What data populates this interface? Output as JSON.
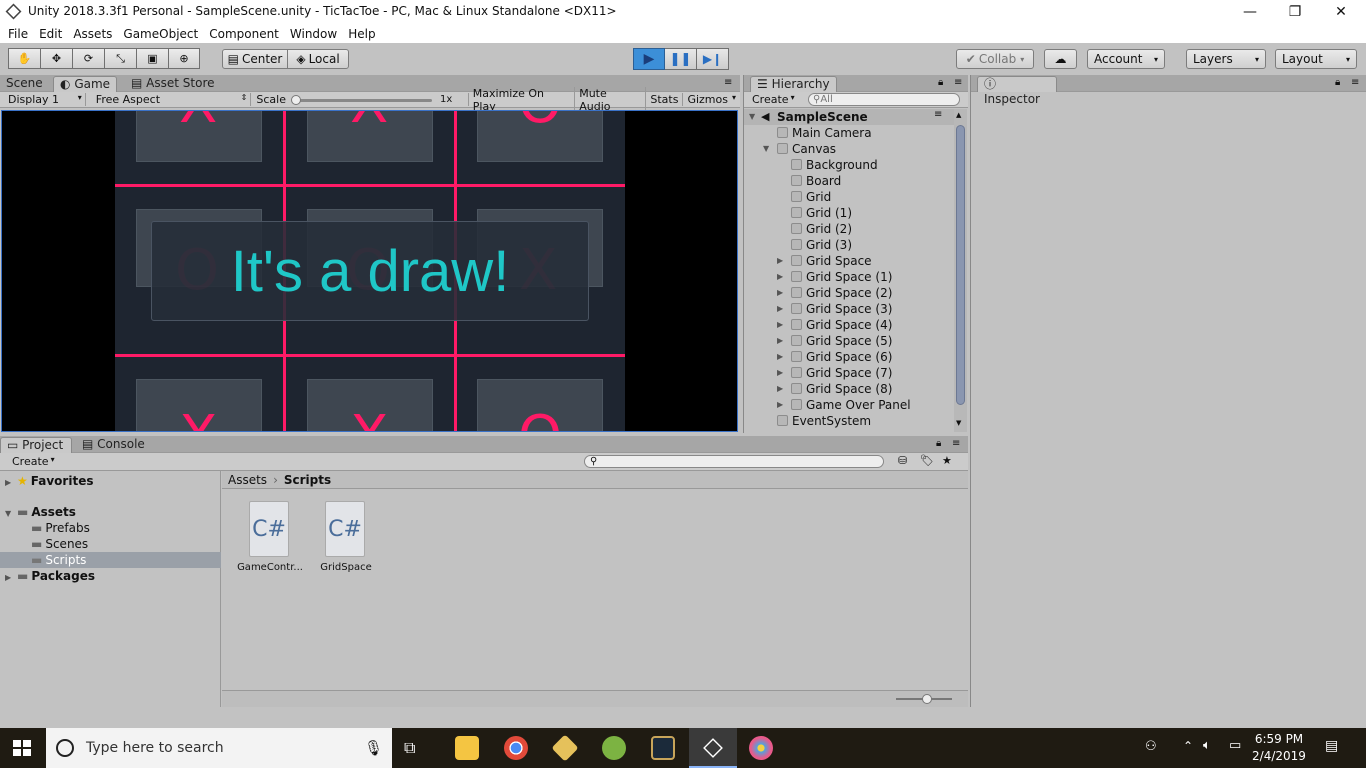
{
  "window": {
    "title": "Unity 2018.3.3f1 Personal - SampleScene.unity - TicTacToe - PC, Mac & Linux Standalone <DX11>"
  },
  "menu": [
    "File",
    "Edit",
    "Assets",
    "GameObject",
    "Component",
    "Window",
    "Help"
  ],
  "toolbar": {
    "center": "Center",
    "local": "Local",
    "collab": "Collab",
    "account": "Account",
    "layers": "Layers",
    "layout": "Layout"
  },
  "tabs": {
    "scene": "Scene",
    "game": "Game",
    "asset_store": "Asset Store",
    "hierarchy": "Hierarchy",
    "inspector": "Inspector",
    "project": "Project",
    "console": "Console"
  },
  "game_bar": {
    "display": "Display 1",
    "aspect": "Free Aspect",
    "scale_label": "Scale",
    "scale_value": "1x",
    "maximize": "Maximize On Play",
    "mute": "Mute Audio",
    "stats": "Stats",
    "gizmos": "Gizmos"
  },
  "game": {
    "message": "It's a draw!",
    "marks": [
      "X",
      "X",
      "O",
      "O",
      "O",
      "X",
      "X",
      "X",
      "O"
    ]
  },
  "hierarchy": {
    "create": "Create",
    "search_placeholder": "All",
    "scene": "SampleScene",
    "items": [
      "Main Camera",
      "Canvas",
      "Background",
      "Board",
      "Grid",
      "Grid (1)",
      "Grid (2)",
      "Grid (3)",
      "Grid Space",
      "Grid Space (1)",
      "Grid Space (2)",
      "Grid Space (3)",
      "Grid Space (4)",
      "Grid Space (5)",
      "Grid Space (6)",
      "Grid Space (7)",
      "Grid Space (8)",
      "Game Over Panel",
      "EventSystem"
    ]
  },
  "project": {
    "create": "Create",
    "favorites": "Favorites",
    "assets": "Assets",
    "folders": [
      "Prefabs",
      "Scenes",
      "Scripts"
    ],
    "packages": "Packages",
    "breadcrumb": [
      "Assets",
      "Scripts"
    ],
    "files": [
      {
        "name": "GameContr...",
        "icon": "C#"
      },
      {
        "name": "GridSpace",
        "icon": "C#"
      }
    ]
  },
  "taskbar": {
    "search_placeholder": "Type here to search",
    "time": "6:59 PM",
    "date": "2/4/2019"
  },
  "colors": {
    "accent_line": "#ff1a66",
    "draw_text": "#1fc7c7",
    "play_active": "#3c8fd8"
  }
}
